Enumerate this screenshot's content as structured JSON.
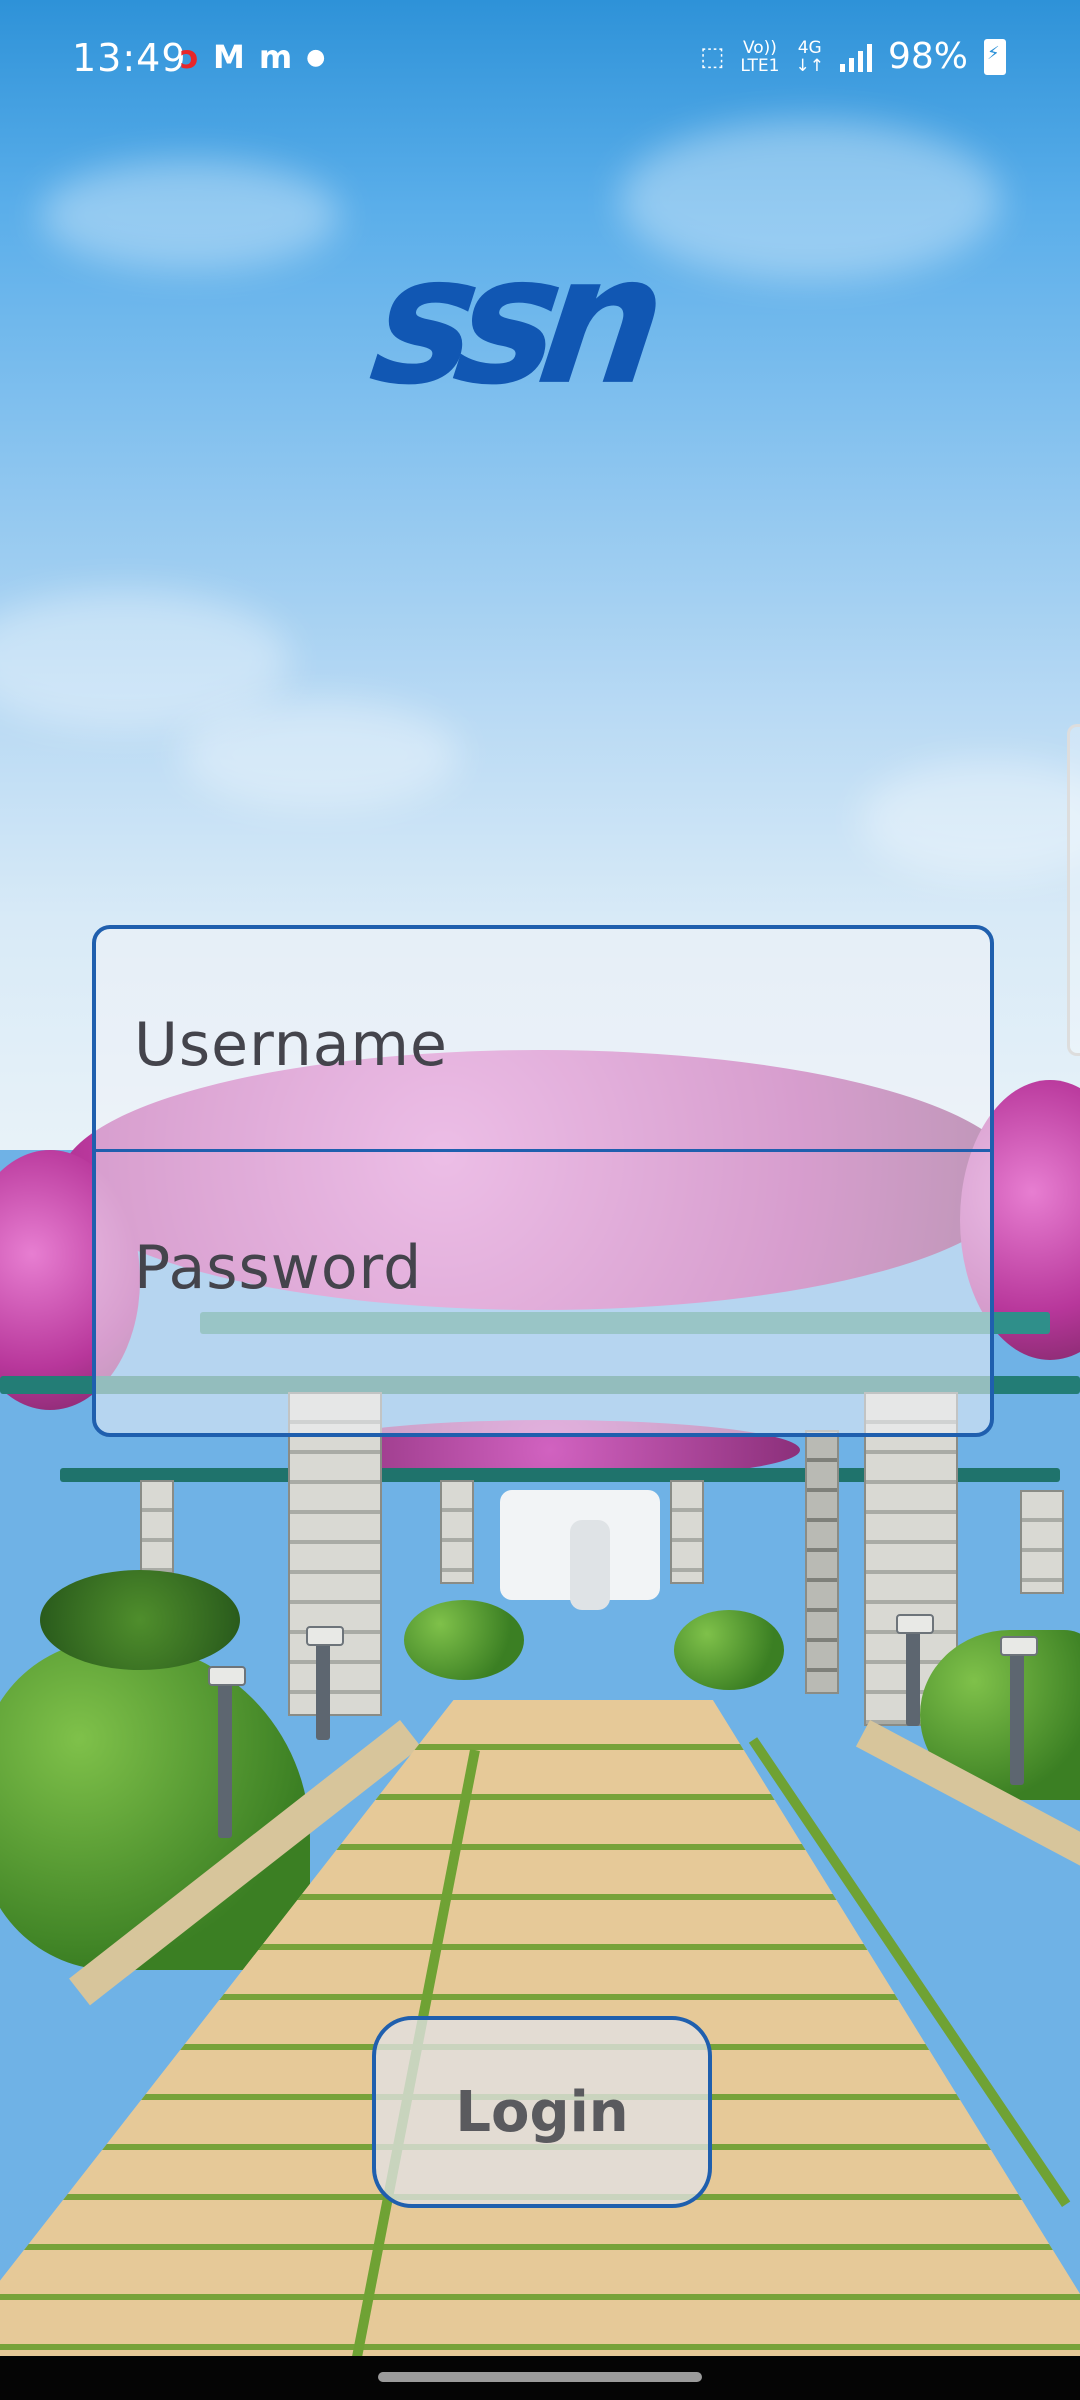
{
  "status_bar": {
    "time": "13:49",
    "network_top": "Vo))",
    "network_bottom": "LTE1",
    "network_type": "4G",
    "battery": "98%",
    "notification_icons": [
      "airtel-icon",
      "myntra-icon",
      "meesho-icon",
      "dot-icon"
    ]
  },
  "logo": {
    "text": "ssn",
    "color": "#1157b3"
  },
  "login_form": {
    "username_placeholder": "Username",
    "password_placeholder": "Password",
    "border_color": "#1f5fae"
  },
  "login_button": {
    "label": "Login"
  }
}
